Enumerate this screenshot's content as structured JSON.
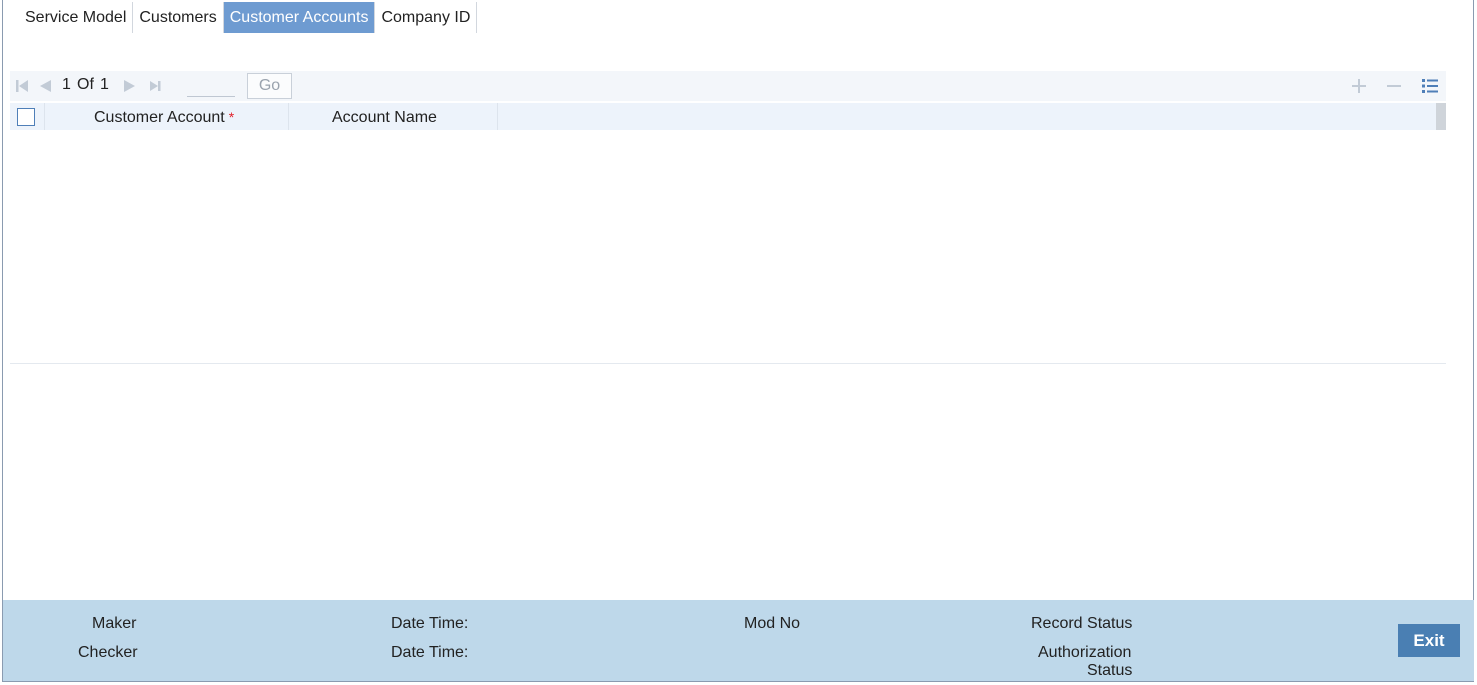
{
  "tabs": [
    {
      "label": "Service Model",
      "active": false
    },
    {
      "label": "Customers",
      "active": false
    },
    {
      "label": "Customer Accounts",
      "active": true
    },
    {
      "label": "Company ID",
      "active": false
    }
  ],
  "pager": {
    "current_page": "1",
    "of_label": "Of",
    "total_pages": "1",
    "page_input_value": "",
    "go_label": "Go"
  },
  "grid": {
    "columns": [
      {
        "label": "Customer Account",
        "required": true,
        "required_marker": "*"
      },
      {
        "label": "Account Name",
        "required": false
      }
    ],
    "rows": []
  },
  "icons": {
    "first": "first-page-icon",
    "prev": "previous-page-icon",
    "next": "next-page-icon",
    "last": "last-page-icon",
    "add": "add-row-icon",
    "delete": "delete-row-icon",
    "view": "single-view-icon"
  },
  "footer": {
    "maker": "Maker",
    "checker": "Checker",
    "maker_datetime": "Date Time:",
    "checker_datetime": "Date Time:",
    "mod_no": "Mod No",
    "record_status": "Record Status",
    "auth_status_line1": "Authorization",
    "auth_status_line2": "Status",
    "exit_label": "Exit"
  },
  "colors": {
    "active_tab": "#6e9bd1",
    "footer_bg": "#bed8ea",
    "exit_button": "#4a7fb3",
    "required_marker": "#e0202a"
  }
}
